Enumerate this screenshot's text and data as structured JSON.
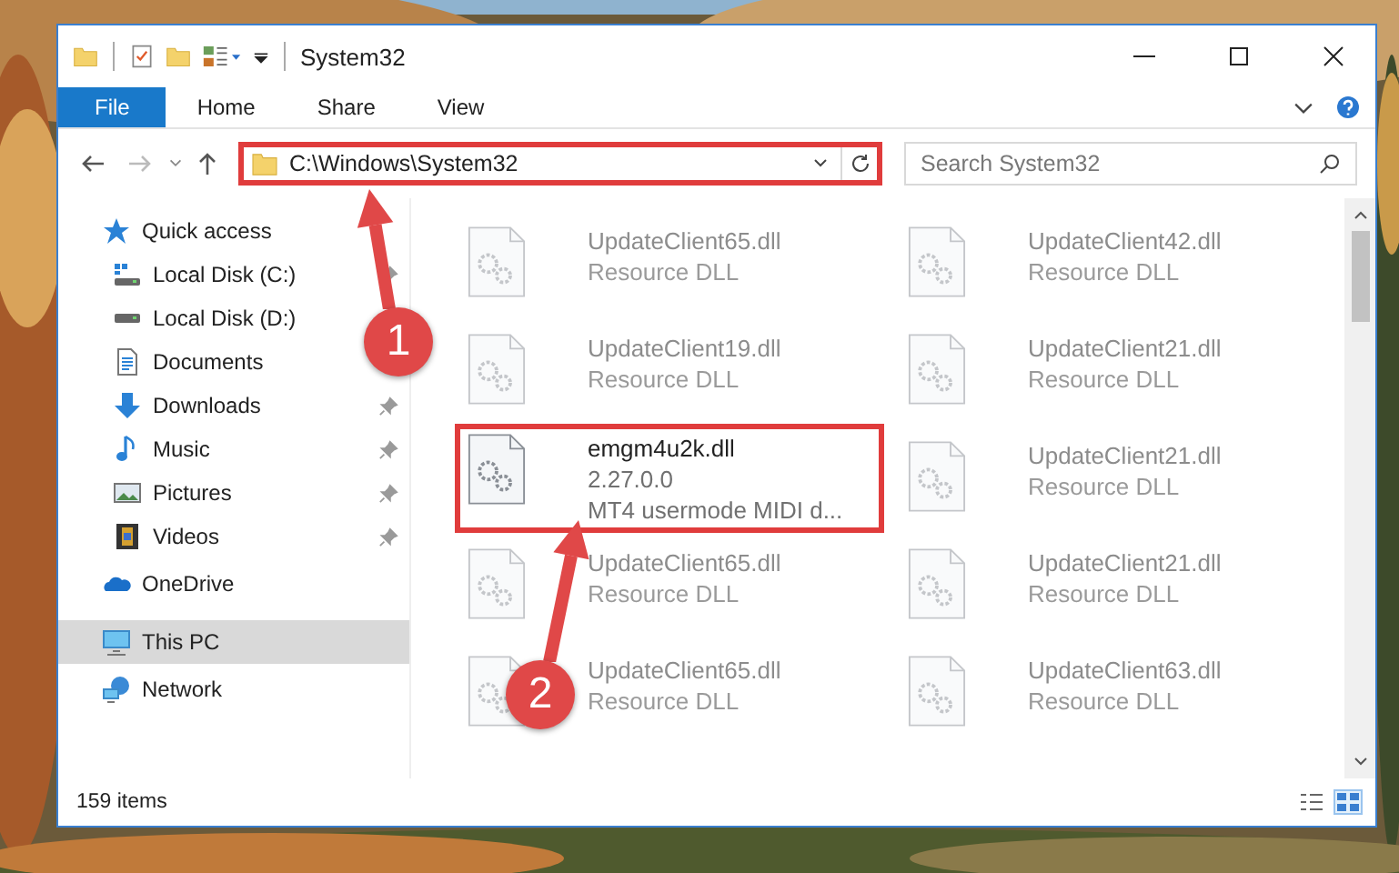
{
  "window": {
    "title": "System32"
  },
  "ribbon_tabs": [
    {
      "label": "File",
      "selected": true
    },
    {
      "label": "Home",
      "selected": false
    },
    {
      "label": "Share",
      "selected": false
    },
    {
      "label": "View",
      "selected": false
    }
  ],
  "address": {
    "path": "C:\\Windows\\System32",
    "highlighted": true
  },
  "search": {
    "placeholder": "Search System32"
  },
  "sidebar": {
    "items": [
      {
        "label": "Quick access",
        "kind": "star",
        "selected": false,
        "children": [
          {
            "label": "Local Disk (C:)",
            "kind": "system-drive",
            "pinned": true
          },
          {
            "label": "Local Disk (D:)",
            "kind": "drive",
            "pinned": false
          },
          {
            "label": "Documents",
            "kind": "documents",
            "pinned": false
          },
          {
            "label": "Downloads",
            "kind": "downloads",
            "pinned": true
          },
          {
            "label": "Music",
            "kind": "music",
            "pinned": true
          },
          {
            "label": "Pictures",
            "kind": "pictures",
            "pinned": true
          },
          {
            "label": "Videos",
            "kind": "videos",
            "pinned": true
          }
        ]
      },
      {
        "label": "OneDrive",
        "kind": "cloud",
        "selected": false
      },
      {
        "label": "This PC",
        "kind": "computer",
        "selected": true
      },
      {
        "label": "Network",
        "kind": "network",
        "selected": false
      }
    ]
  },
  "files": [
    {
      "lines": [
        "UpdateClient65.dll",
        "Resource DLL"
      ],
      "dimmed": true,
      "highlighted": false
    },
    {
      "lines": [
        "UpdateClient42.dll",
        "Resource DLL"
      ],
      "dimmed": true,
      "highlighted": false
    },
    {
      "lines": [
        "UpdateClient19.dll",
        "Resource DLL"
      ],
      "dimmed": true,
      "highlighted": false
    },
    {
      "lines": [
        "UpdateClient21.dll",
        "Resource DLL"
      ],
      "dimmed": true,
      "highlighted": false
    },
    {
      "lines": [
        "emgm4u2k.dll",
        "2.27.0.0",
        "MT4 usermode MIDI d..."
      ],
      "dimmed": false,
      "highlighted": true
    },
    {
      "lines": [
        "UpdateClient21.dll",
        "Resource DLL"
      ],
      "dimmed": true,
      "highlighted": false
    },
    {
      "lines": [
        "UpdateClient65.dll",
        "Resource DLL"
      ],
      "dimmed": true,
      "highlighted": false
    },
    {
      "lines": [
        "UpdateClient21.dll",
        "Resource DLL"
      ],
      "dimmed": true,
      "highlighted": false
    },
    {
      "lines": [
        "UpdateClient65.dll",
        "Resource DLL"
      ],
      "dimmed": true,
      "highlighted": false
    },
    {
      "lines": [
        "UpdateClient63.dll",
        "Resource DLL"
      ],
      "dimmed": true,
      "highlighted": false
    }
  ],
  "status_bar": {
    "item_count": "159 items"
  },
  "callouts": [
    {
      "number": "1"
    },
    {
      "number": "2"
    }
  ]
}
